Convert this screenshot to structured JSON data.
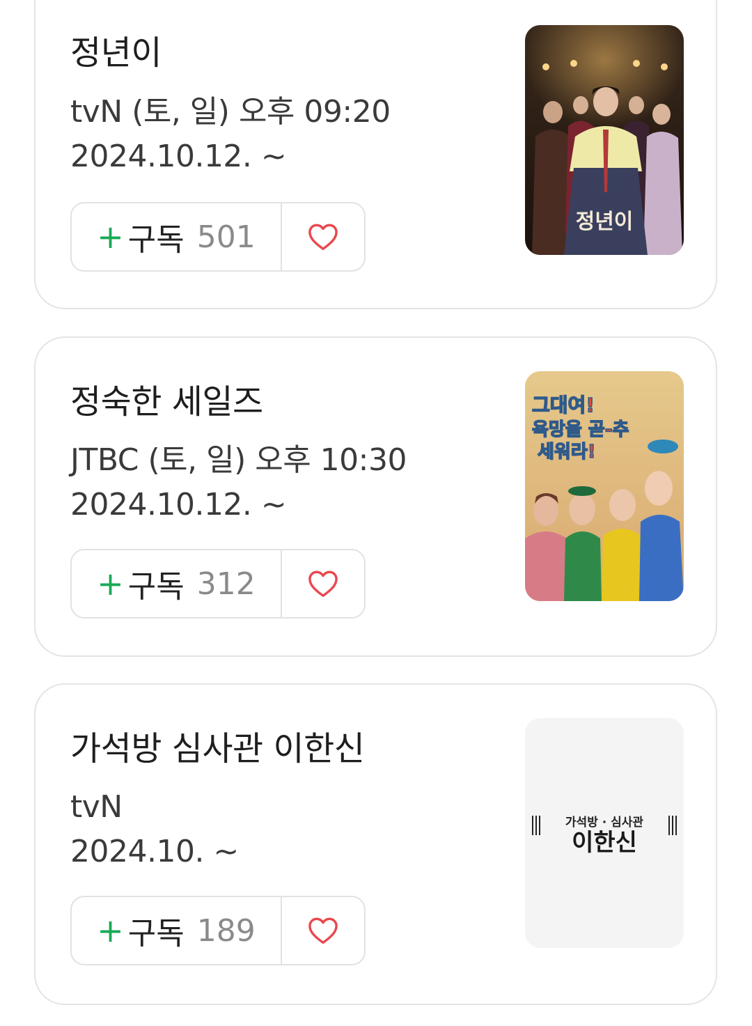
{
  "shows": [
    {
      "title": "정년이",
      "channel_time": "tvN (토, 일) 오후 09:20",
      "date": "2024.10.12. ~",
      "subscribe_label": "구독",
      "subscribe_count": "501",
      "poster_text": "정년이"
    },
    {
      "title": "정숙한 세일즈",
      "channel_time": "JTBC (토, 일) 오후 10:30",
      "date": "2024.10.12. ~",
      "subscribe_label": "구독",
      "subscribe_count": "312",
      "poster_text_line1": "그대여!",
      "poster_text_line2": "욕망을 곧-추",
      "poster_text_line3": "세워라!"
    },
    {
      "title": "가석방 심사관 이한신",
      "channel_time": "tvN",
      "date": "2024.10. ~",
      "subscribe_label": "구독",
      "subscribe_count": "189",
      "poster_text_small": "가석방 · 심사관",
      "poster_text_large": "이한신"
    }
  ],
  "icons": {
    "plus": "+",
    "heart": "heart-outline-icon"
  },
  "colors": {
    "accent_green": "#1aa957",
    "heart_red": "#e8484f"
  }
}
